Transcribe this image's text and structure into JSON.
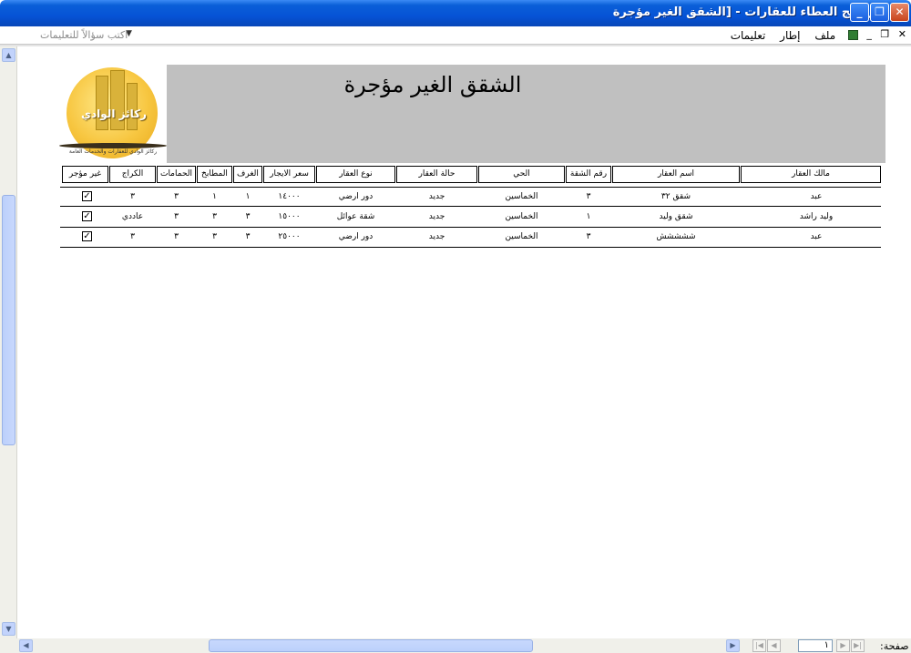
{
  "window": {
    "title": "[برنامج العطاء للعقارات - [الشقق الغير مؤجرة",
    "buttons": {
      "minimize": "_",
      "restore": "❐",
      "close": "✕"
    }
  },
  "menu": {
    "items": [
      "ملف",
      "إطار",
      "تعليمات"
    ],
    "mdi_controls": [
      "✕",
      "❐",
      "_"
    ],
    "ask_placeholder": "اكتب سؤالاً للتعليمات"
  },
  "report": {
    "title": "الشقق الغير مؤجرة",
    "logo_text": "ركائز الوادي",
    "logo_subtext": "ركائز الوادي للعقارات والخدمات العامة",
    "columns": [
      "مالك العقار",
      "اسم العقار",
      "رقم الشقة",
      "الحي",
      "حالة العقار",
      "نوع العقار",
      "سعر الايجار",
      "الغرف",
      "المطابخ",
      "الحمامات",
      "الكراج",
      "غير مؤجر"
    ],
    "rows": [
      {
        "owner": "عبد",
        "property": "شقق ٣٢",
        "apartment": "٣",
        "district": "الخماسين",
        "status": "جديد",
        "type": "دور ارضي",
        "rent": "١٤٠٠٠",
        "rooms": "١",
        "kitchens": "١",
        "bathrooms": "٣",
        "garage": "٣",
        "not_rented": true
      },
      {
        "owner": "وليد راشد",
        "property": "شقق وليد",
        "apartment": "١",
        "district": "الخماسين",
        "status": "جديد",
        "type": "شقة عوائل",
        "rent": "١٥٠٠٠",
        "rooms": "٣",
        "kitchens": "٣",
        "bathrooms": "٣",
        "garage": "عاددي",
        "not_rented": true
      },
      {
        "owner": "عبد",
        "property": "ششششش",
        "apartment": "٣",
        "district": "الخماسين",
        "status": "جديد",
        "type": "دور ارضي",
        "rent": "٢٥٠٠٠",
        "rooms": "٣",
        "kitchens": "٣",
        "bathrooms": "٣",
        "garage": "٣",
        "not_rented": true
      }
    ]
  },
  "navigation": {
    "page_label": "صفحة:",
    "page_number": "١"
  },
  "colors": {
    "titlebar": "#0653d6",
    "header_band": "#c0c0c0",
    "scroll_thumb": "#bcd0fb"
  }
}
